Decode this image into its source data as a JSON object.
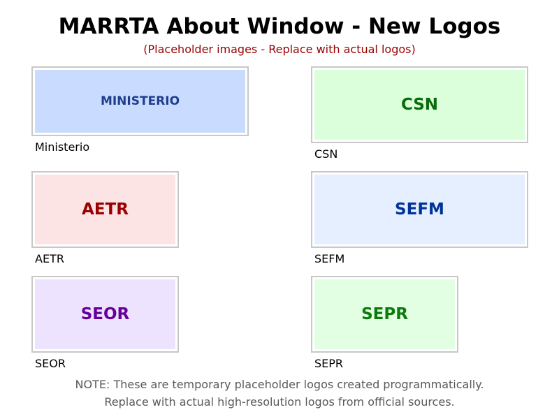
{
  "header": {
    "title": "MARRTA About Window - New Logos",
    "subtitle": "(Placeholder images - Replace with actual logos)",
    "subtitle_color": "#990000"
  },
  "logos": [
    {
      "logo_text": "MINISTERIO",
      "caption": "Ministerio",
      "bg_color": "#c9dcff",
      "text_color": "#1f3d8c"
    },
    {
      "logo_text": "CSN",
      "caption": "CSN",
      "bg_color": "#dbffdb",
      "text_color": "#0a6b0a"
    },
    {
      "logo_text": "AETR",
      "caption": "AETR",
      "bg_color": "#fde4e4",
      "text_color": "#990000"
    },
    {
      "logo_text": "SEFM",
      "caption": "SEFM",
      "bg_color": "#e5efff",
      "text_color": "#003399"
    },
    {
      "logo_text": "SEOR",
      "caption": "SEOR",
      "bg_color": "#ede3ff",
      "text_color": "#660099"
    },
    {
      "logo_text": "SEPR",
      "caption": "SEPR",
      "bg_color": "#e3ffe3",
      "text_color": "#0d7a0d"
    }
  ],
  "footer": {
    "note_line1": "NOTE: These are temporary placeholder logos created programmatically.",
    "note_line2": "Replace with actual high-resolution logos from official sources."
  }
}
